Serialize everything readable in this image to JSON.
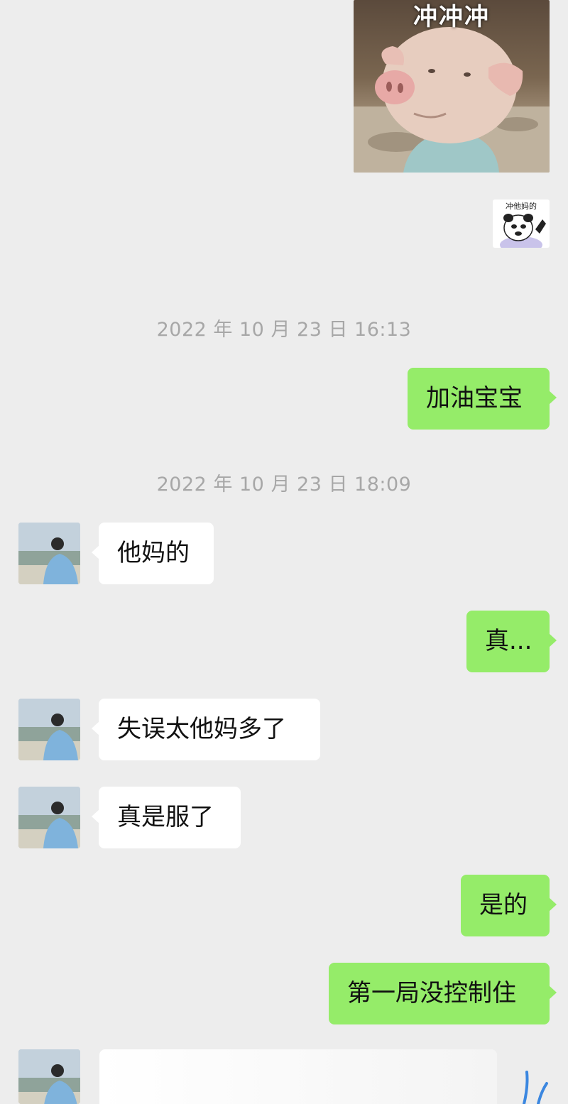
{
  "stickers": {
    "pig_caption": "冲冲冲",
    "panda_caption": "冲他妈的"
  },
  "timestamps": {
    "first": "2022 年 10 月 23 日 16:13",
    "second": "2022 年 10 月 23 日 18:09"
  },
  "messages": [
    {
      "side": "right",
      "text": "加油宝宝"
    },
    {
      "side": "left",
      "text": "他妈的"
    },
    {
      "side": "right",
      "text": "真..."
    },
    {
      "side": "left",
      "text": "失误太他妈多了"
    },
    {
      "side": "left",
      "text": "真是服了"
    },
    {
      "side": "right",
      "text": "是的"
    },
    {
      "side": "right",
      "text": "第一局没控制住"
    }
  ],
  "colors": {
    "background": "#ededed",
    "sent_bubble": "#95ec69",
    "received_bubble": "#ffffff",
    "timestamp_text": "#a7a7a7"
  }
}
